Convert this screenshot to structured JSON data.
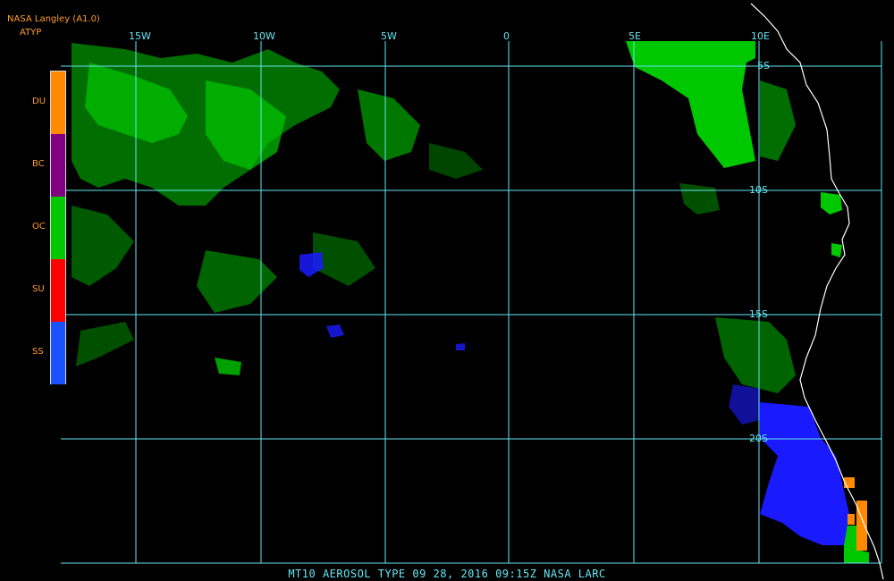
{
  "header": {
    "title": "NASA Langley (A1.0)",
    "product": "ATYP"
  },
  "legend": {
    "items": [
      {
        "label": "DU",
        "color": "#ff8a00"
      },
      {
        "label": "BC",
        "color": "#800080"
      },
      {
        "label": "OC",
        "color": "#00c800"
      },
      {
        "label": "SU",
        "color": "#ff0000"
      },
      {
        "label": "SS",
        "color": "#1a52ff"
      }
    ]
  },
  "grid": {
    "longitudes": [
      "15W",
      "10W",
      "5W",
      "0",
      "5E",
      "10E"
    ],
    "latitudes": [
      "5S",
      "10S",
      "15S",
      "20S"
    ],
    "line_color": "#66e6f2"
  },
  "coast_color": "#ffffff",
  "caption": "MT10  AEROSOL TYPE  09 28, 2016 09:15Z  NASA LARC"
}
